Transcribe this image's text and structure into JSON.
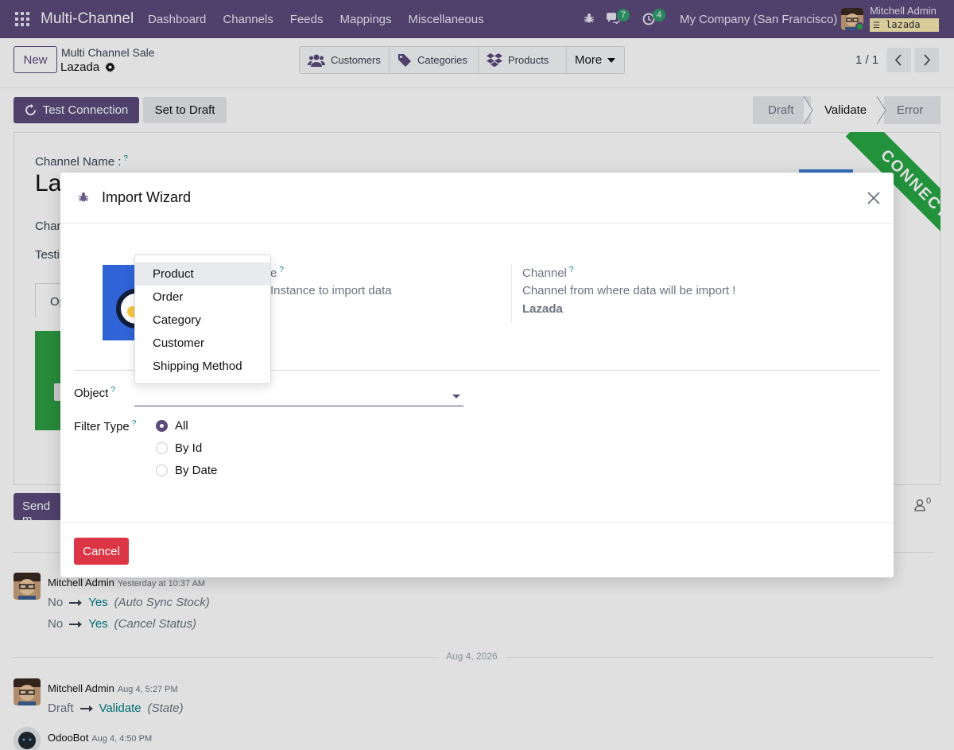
{
  "topnav": {
    "brand": "Multi-Channel",
    "menu": [
      "Dashboard",
      "Channels",
      "Feeds",
      "Mappings",
      "Miscellaneous"
    ],
    "messages_count": "7",
    "activities_count": "4",
    "company": "My Company (San Francisco)",
    "user_name": "Mitchell Admin",
    "database": "lazada"
  },
  "control": {
    "new_label": "New",
    "breadcrumb_parent": "Multi Channel Sale",
    "breadcrumb_current": "Lazada",
    "smart_buttons": [
      "Customers",
      "Categories",
      "Products",
      "More"
    ],
    "pager": "1 / 1"
  },
  "statusbar": {
    "test_connection": "Test Connection",
    "set_to_draft": "Set to Draft",
    "stages": [
      "Draft",
      "Validate",
      "Error"
    ]
  },
  "form_background": {
    "channel_name_label": "Channel Name :",
    "channel_name_partial": "La",
    "row1_partial": "Chan",
    "row2_partial": "Testi",
    "tab_partial": "Op",
    "send_partial": "Send m",
    "ribbon": "CONNECTED",
    "followers_count": "0"
  },
  "modal": {
    "title": "Import Wizard",
    "instance_label_partial": "e",
    "instance_desc_partial": "Instance to import data",
    "channel_label": "Channel",
    "channel_desc": "Channel from where data will be import !",
    "channel_value": "Lazada",
    "object_label": "Object",
    "filter_type_label": "Filter Type",
    "filter_options": [
      "All",
      "By Id",
      "By Date"
    ],
    "cancel": "Cancel",
    "object_dropdown": [
      "Product",
      "Order",
      "Category",
      "Customer",
      "Shipping Method"
    ],
    "help_mark": "?"
  },
  "chatter": {
    "messages": [
      {
        "author": "Mitchell Admin",
        "time": "Yesterday at 10:37 AM",
        "changes": [
          {
            "old": "No",
            "new": "Yes",
            "field": "(Auto Sync Stock)"
          },
          {
            "old": "No",
            "new": "Yes",
            "field": "(Cancel Status)"
          }
        ]
      },
      {
        "author": "Mitchell Admin",
        "time": "Aug 4, 5:27 PM",
        "changes": [
          {
            "old": "Draft",
            "new": "Validate",
            "field": "(State)"
          }
        ]
      },
      {
        "author": "OdooBot",
        "time": "Aug 4, 4:50 PM"
      }
    ],
    "date_separator": "Aug 4, 2026"
  },
  "colors": {
    "brand": "#5b4b7c",
    "ribbon": "#28a745",
    "danger": "#dc3545",
    "teal": "#017e84"
  }
}
